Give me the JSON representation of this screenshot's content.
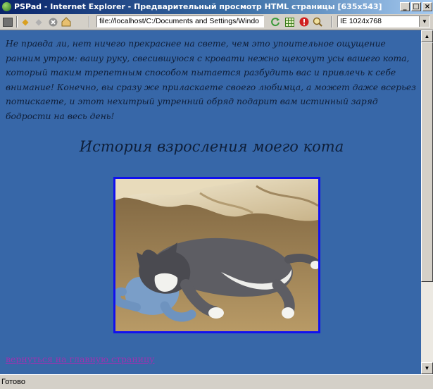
{
  "window": {
    "title": "PSPad - Internet Explorer - Предварительный просмотр HTML страницы  [635x543]",
    "minimize_label": "_",
    "maximize_label": "□",
    "close_label": "×"
  },
  "toolbar": {
    "address": "file://localhost/C:/Documents and Settings/Windo",
    "size_option": "IE 1024x768"
  },
  "page": {
    "intro_text": "Не правда ли, нет ничего прекраснее на свете, чем это упоительное ощущение ранним утром: вашу руку, свесившуюся с кровати нежно щекочут усы вашего кота, который таким трепетным способом пытается разбудить вас и привлечь к себе внимание! Конечно, вы сразу же приласкаете своего любимца, а может даже всерьез потискаете, и этот нехитрый утренний обряд подарит вам истинный заряд бодрости на весь день!",
    "heading": "История взросления моего кота",
    "back_link": "вернуться на главную страницу"
  },
  "status": {
    "text": "Готово"
  },
  "colors": {
    "page_background": "#3767a8",
    "text": "#0f1f3a",
    "photo_border": "#1111ee",
    "link": "#9c33b0"
  }
}
